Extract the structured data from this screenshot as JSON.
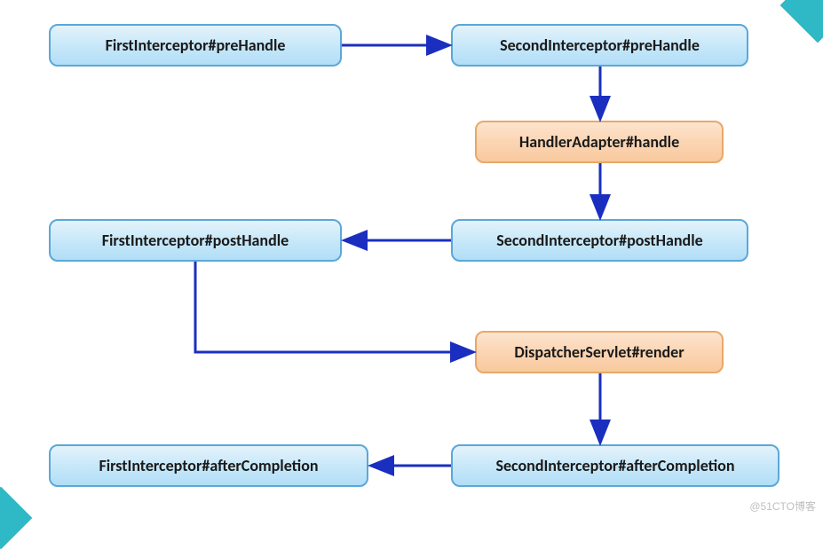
{
  "nodes": {
    "first_pre": {
      "label": "FirstInterceptor#preHandle"
    },
    "second_pre": {
      "label": "SecondInterceptor#preHandle"
    },
    "handler": {
      "label": "HandlerAdapter#handle"
    },
    "first_post": {
      "label": "FirstInterceptor#postHandle"
    },
    "second_post": {
      "label": "SecondInterceptor#postHandle"
    },
    "render": {
      "label": "DispatcherServlet#render"
    },
    "first_after": {
      "label": "FirstInterceptor#afterCompletion"
    },
    "second_after": {
      "label": "SecondInterceptor#afterCompletion"
    }
  },
  "watermark": "@51CTO博客",
  "colors": {
    "arrow": "#1a2fbf",
    "blueFill": "#c8e8f9",
    "blueStroke": "#5aa8d8",
    "orangeFill": "#fbd5b3",
    "orangeStroke": "#e8a868"
  },
  "flow": [
    [
      "first_pre",
      "second_pre"
    ],
    [
      "second_pre",
      "handler"
    ],
    [
      "handler",
      "second_post"
    ],
    [
      "second_post",
      "first_post"
    ],
    [
      "first_post",
      "render"
    ],
    [
      "render",
      "second_after"
    ],
    [
      "second_after",
      "first_after"
    ]
  ]
}
